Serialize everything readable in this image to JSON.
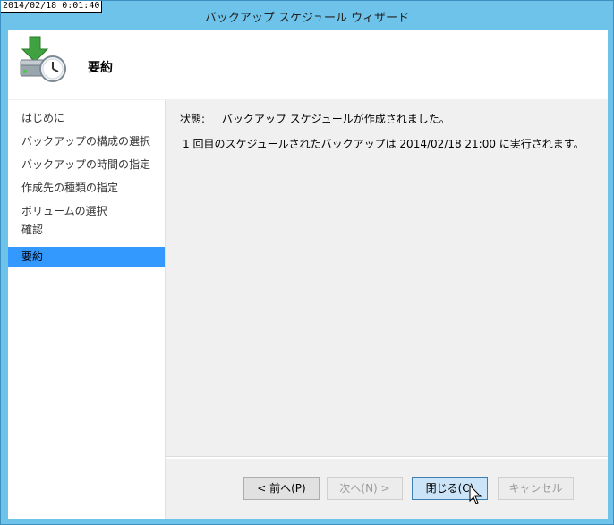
{
  "screen": {
    "timestamp": "2014/02/18 0:01:40"
  },
  "window": {
    "title": "バックアップ スケジュール ウィザード"
  },
  "header": {
    "title": "要約",
    "icon": "backup-schedule-icon"
  },
  "nav": {
    "items": [
      {
        "label": "はじめに"
      },
      {
        "label": "バックアップの構成の選択"
      },
      {
        "label": "バックアップの時間の指定"
      },
      {
        "label": "作成先の種類の指定"
      },
      {
        "label": "ボリュームの選択"
      },
      {
        "label": "確認"
      },
      {
        "label": "要約",
        "active": true
      }
    ]
  },
  "content": {
    "status_label": "状態:",
    "status_value": "バックアップ スケジュールが作成されました。",
    "detail": "1 回目のスケジュールされたバックアップは 2014/02/18 21:00 に実行されます。"
  },
  "buttons": {
    "back": "< 前へ(P)",
    "next": "次へ(N) >",
    "close": "閉じる(C)",
    "cancel": "キャンセル"
  }
}
